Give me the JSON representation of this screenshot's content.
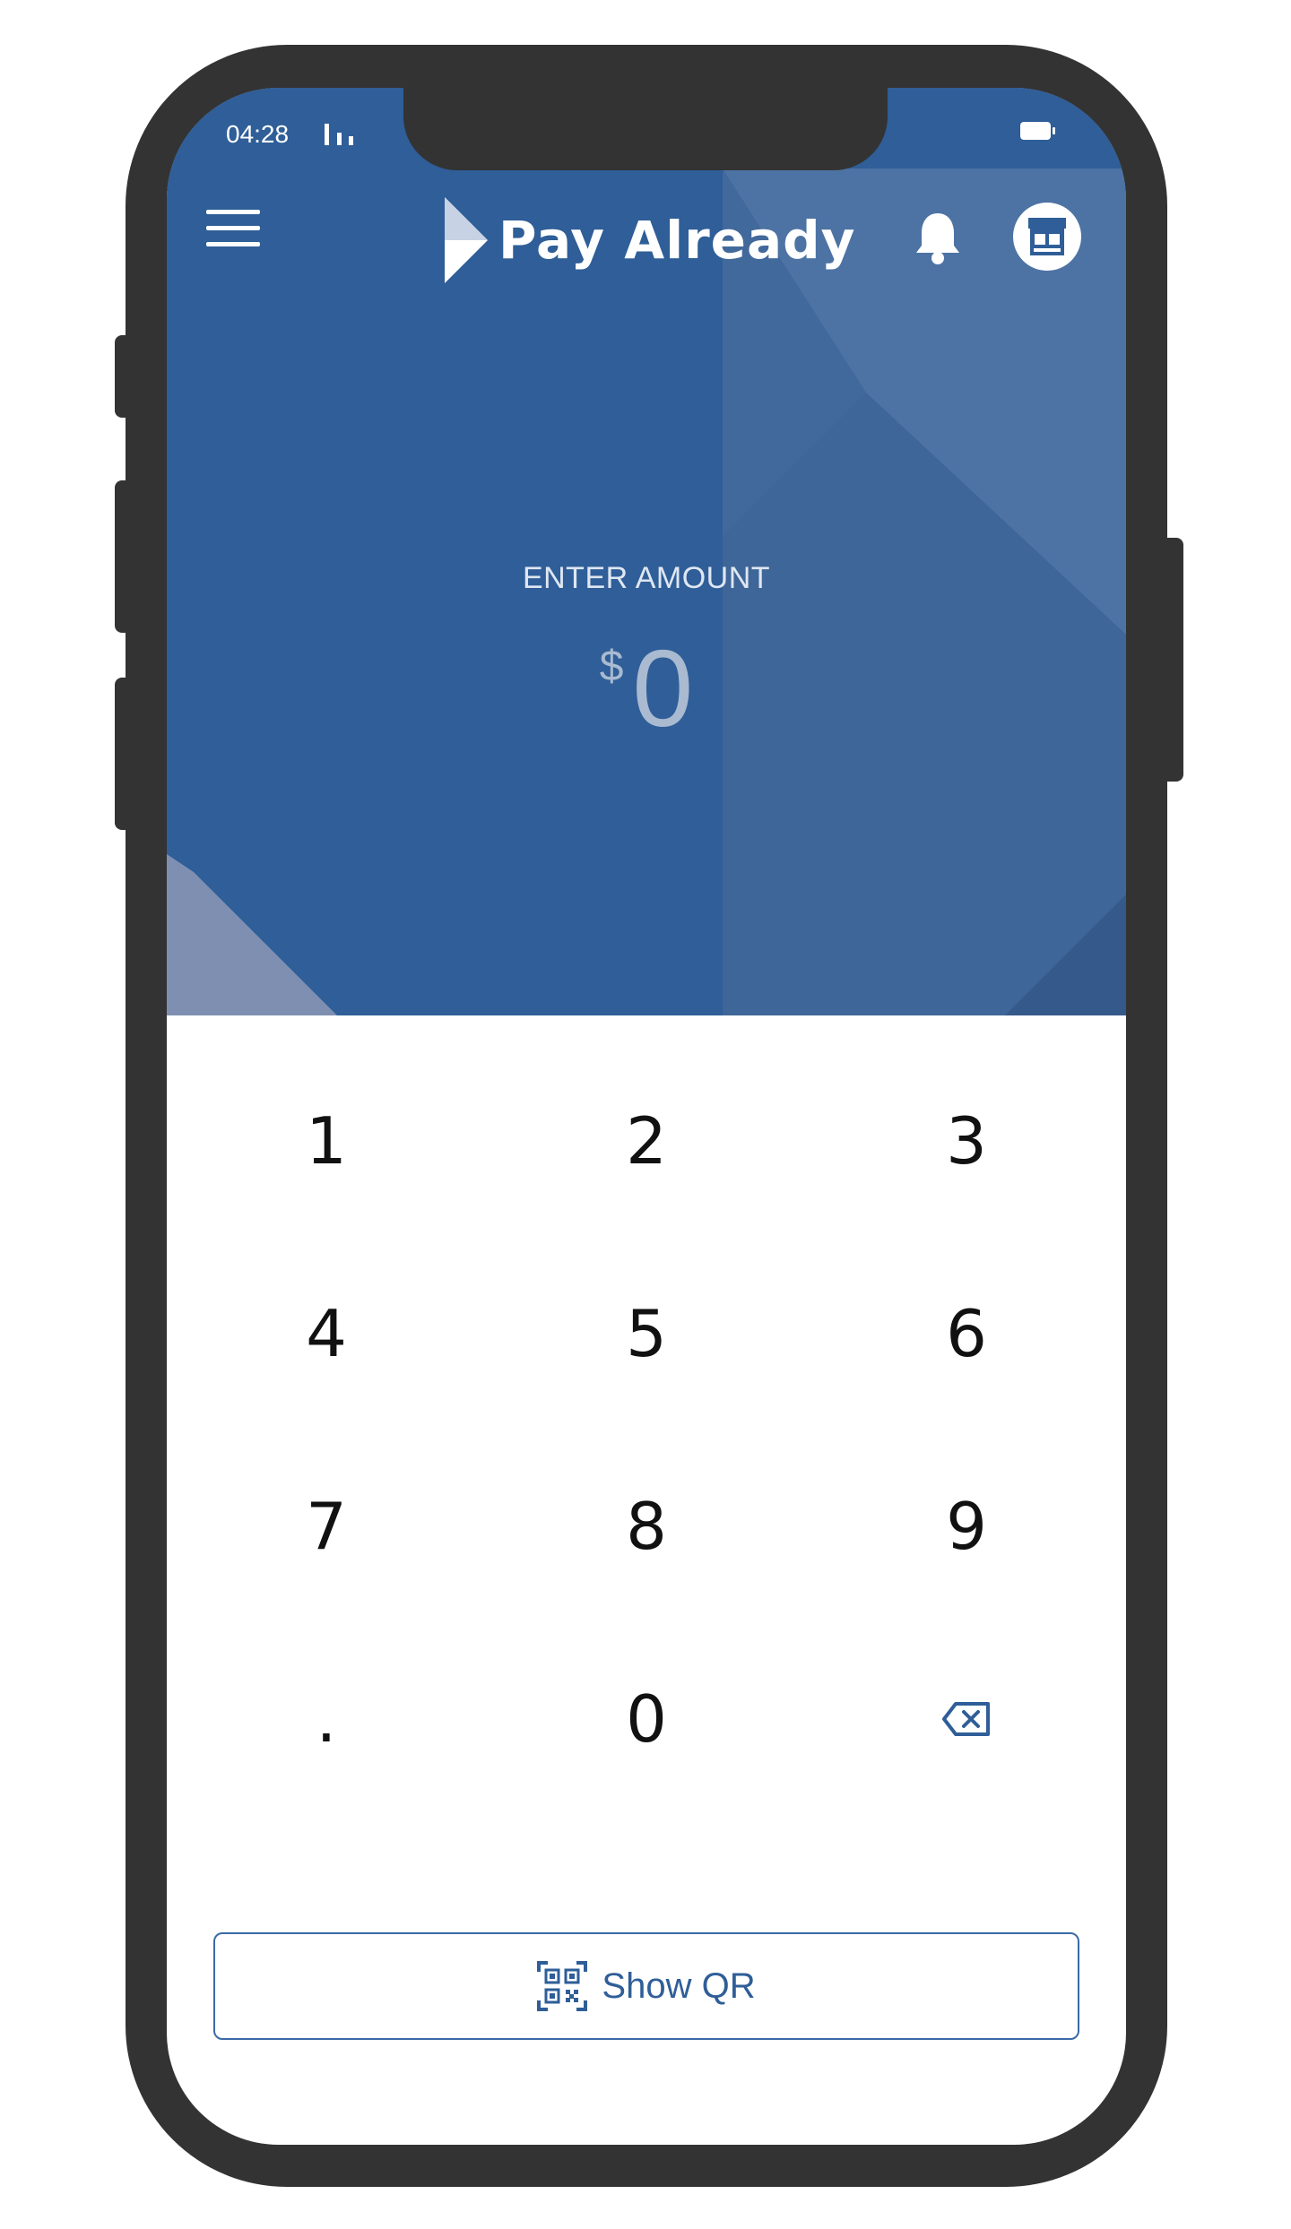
{
  "status_bar": {
    "time": "04:28"
  },
  "header": {
    "brand": "Pay Already"
  },
  "amount": {
    "label": "ENTER AMOUNT",
    "currency": "$",
    "value": "0"
  },
  "keypad": {
    "keys": [
      "1",
      "2",
      "3",
      "4",
      "5",
      "6",
      "7",
      "8",
      "9",
      ".",
      "0"
    ]
  },
  "actions": {
    "show_qr_label": "Show QR"
  },
  "colors": {
    "primary": "#2f5e98",
    "frame": "#333333",
    "accent_text": "#a9bad1"
  },
  "icons": [
    "menu-icon",
    "bell-icon",
    "store-icon",
    "backspace-icon",
    "qr-code-icon"
  ]
}
